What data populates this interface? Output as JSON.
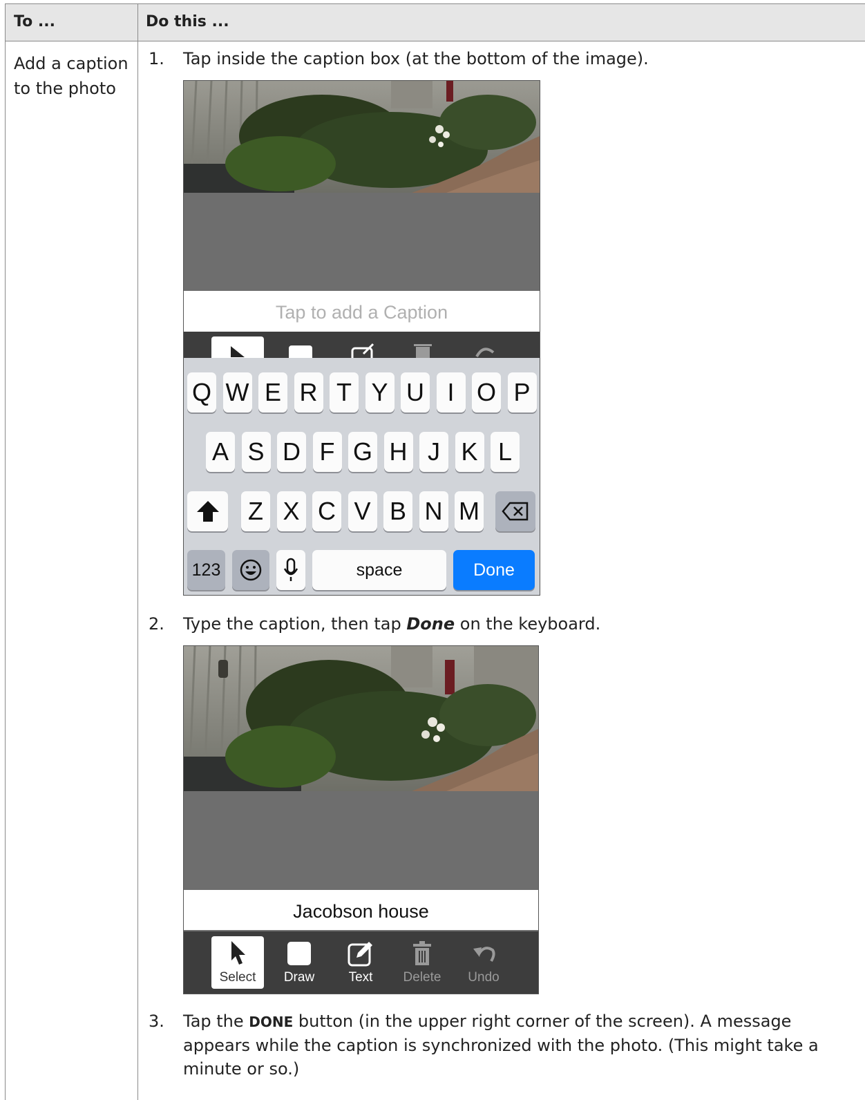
{
  "table": {
    "header_col1": "To ...",
    "header_col2": "Do this ...",
    "task": "Add a caption to the photo"
  },
  "steps": [
    {
      "num": "1.",
      "text": "Tap inside the caption box (at the bottom of the image)."
    },
    {
      "num": "2.",
      "pre": "Type the caption, then tap ",
      "em": "Done",
      "post": " on the keyboard."
    },
    {
      "num": "3.",
      "pre": "Tap the ",
      "strong": "DONE",
      "post": " button (in the upper right corner of the screen). A message appears while the caption is synchronized with the photo. (This might take a minute or so.)"
    }
  ],
  "shot1": {
    "caption_placeholder": "Tap to add a Caption",
    "keyboard": {
      "row1": [
        "Q",
        "W",
        "E",
        "R",
        "T",
        "Y",
        "U",
        "I",
        "O",
        "P"
      ],
      "row2": [
        "A",
        "S",
        "D",
        "F",
        "G",
        "H",
        "J",
        "K",
        "L"
      ],
      "row3": [
        "Z",
        "X",
        "C",
        "V",
        "B",
        "N",
        "M"
      ],
      "numbers_key": "123",
      "space_key": "space",
      "done_key": "Done",
      "icons": {
        "shift": "shift-icon",
        "backspace": "backspace-icon",
        "emoji": "emoji-icon",
        "mic": "microphone-icon"
      },
      "done_color": "#0a7cff"
    }
  },
  "shot2": {
    "caption_text": "Jacobson house",
    "tools": [
      {
        "label": "Select",
        "icon": "select-arrow-icon",
        "active": true
      },
      {
        "label": "Draw",
        "icon": "draw-square-icon",
        "active": false
      },
      {
        "label": "Text",
        "icon": "text-edit-icon",
        "active": false
      },
      {
        "label": "Delete",
        "icon": "trash-icon",
        "active": false,
        "disabled": true
      },
      {
        "label": "Undo",
        "icon": "undo-icon",
        "active": false,
        "disabled": true
      }
    ]
  }
}
